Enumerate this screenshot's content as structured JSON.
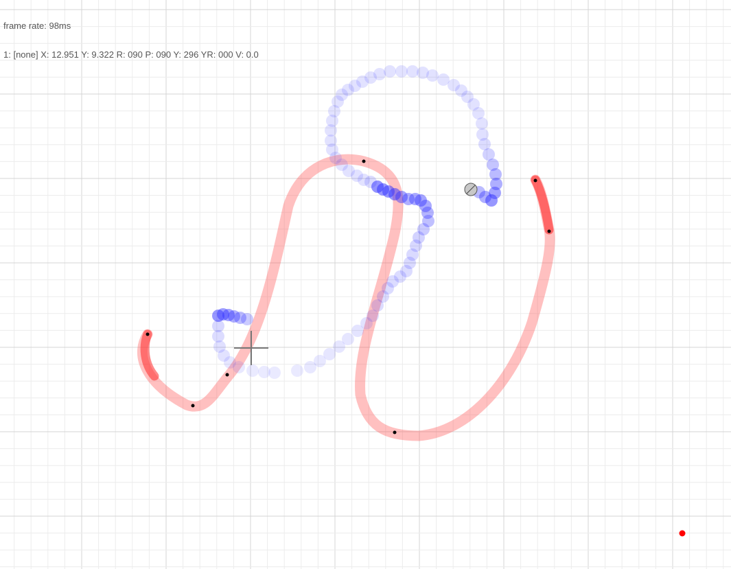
{
  "hud": {
    "frame_rate_text": "frame rate: 98ms",
    "status_text": "1: [none] X: 12.951 Y: 9.322 R: 090 P: 090 Y: 296 YR: 000 V: 0.0"
  },
  "colors": {
    "background": "#ffffff",
    "grid_minor": "#ececec",
    "grid_major": "#d4d4d4",
    "path_red": "#ff4a4a",
    "path_red_dark": "#e60000",
    "trail_blue": "#3030ff",
    "trail_blue_light": "#aeb4ff",
    "crosshair": "#888888",
    "marker": "#ff0000"
  }
}
